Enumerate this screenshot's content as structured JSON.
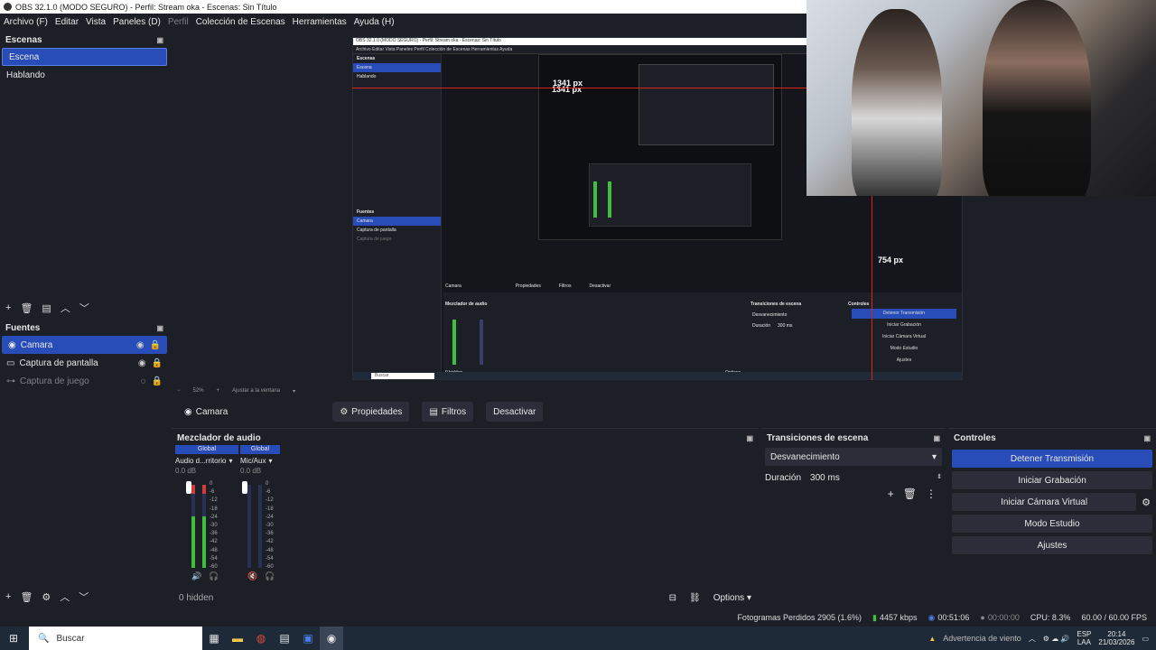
{
  "window": {
    "title": "OBS 32.1.0 (MODO SEGURO) - Perfil: Stream oka - Escenas: Sin Título"
  },
  "menu": [
    {
      "label": "Archivo (F)",
      "disabled": false
    },
    {
      "label": "Editar",
      "disabled": false
    },
    {
      "label": "Vista",
      "disabled": false
    },
    {
      "label": "Paneles (D)",
      "disabled": false
    },
    {
      "label": "Perfil",
      "disabled": true
    },
    {
      "label": "Colección de Escenas",
      "disabled": false
    },
    {
      "label": "Herramientas",
      "disabled": false
    },
    {
      "label": "Ayuda (H)",
      "disabled": false
    }
  ],
  "scenes": {
    "title": "Escenas",
    "items": [
      "Escena",
      "Hablando"
    ]
  },
  "sources": {
    "title": "Fuentes",
    "items": [
      {
        "label": "Camara",
        "icon": "camera-icon"
      },
      {
        "label": "Captura de pantalla",
        "icon": "monitor-icon"
      },
      {
        "label": "Captura de juego",
        "icon": "gamepad-icon"
      }
    ],
    "hidden_label": "0 hidden"
  },
  "preview": {
    "measure_h": "1341 px",
    "measure_v": "754 px",
    "zoom": "52%",
    "fit_label": "Ajustar a la ventana",
    "inner": {
      "menu": "Archivo Editar Vista Paneles Perfil Colección de Escenas Herramientas Ayuda",
      "scenes_title": "Escenas",
      "scenes": [
        "Escena",
        "Hablando"
      ],
      "sources_title": "Fuentes",
      "sources": [
        "Camara",
        "Captura de pantalla",
        "Captura de juego"
      ],
      "measure_h": "1341 px",
      "ctx_source": "Camara",
      "ctx_props": "Propiedades",
      "ctx_filters": "Filtros",
      "ctx_deactivate": "Desactivar",
      "mixer_title": "Mezclador de audio",
      "transitions_title": "Transiciones de escena",
      "transition_value": "Desvanecimiento",
      "duration_label": "Duración",
      "duration_value": "300 ms",
      "controls_title": "Controles",
      "controls": [
        "Detener Transmisión",
        "Iniciar Grabación",
        "Iniciar Cámara Virtual",
        "Modo Estudio",
        "Ajustes"
      ],
      "hidden_label": "0 hidden",
      "options_label": "Options",
      "taskbar_search": "Buscar"
    }
  },
  "context_bar": {
    "source": "Camara",
    "properties": "Propiedades",
    "filters": "Filtros",
    "deactivate": "Desactivar"
  },
  "mixer": {
    "title": "Mezclador de audio",
    "channels": [
      {
        "scope": "Global",
        "name": "Audio d...rritorio",
        "db": "0.0 dB",
        "level": 0.62,
        "clip": true
      },
      {
        "scope": "Global",
        "name": "Mic/Aux",
        "db": "0.0 dB",
        "level": 0.0,
        "clip": false
      }
    ],
    "scale": [
      "0",
      "-6",
      "-12",
      "-18",
      "-24",
      "-30",
      "-36",
      "-42",
      "-48",
      "-54",
      "-60"
    ],
    "options_label": "Options"
  },
  "transitions": {
    "title": "Transiciones de escena",
    "value": "Desvanecimiento",
    "duration_label": "Duración",
    "duration_value": "300 ms"
  },
  "controls": {
    "title": "Controles",
    "stop_stream": "Detener Transmisión",
    "start_recording": "Iniciar Grabación",
    "start_virtualcam": "Iniciar Cámara Virtual",
    "studio_mode": "Modo Estudio",
    "settings": "Ajustes"
  },
  "status": {
    "dropped": "Fotogramas Perdidos 2905 (1.6%)",
    "bitrate": "4457 kbps",
    "stream_time": "00:51:06",
    "rec_time": "00:00:00",
    "cpu": "CPU: 8.3%",
    "fps": "60.00 / 60.00 FPS"
  },
  "taskbar": {
    "search": "Buscar",
    "weather": "Advertencia de viento",
    "lang": "ESP",
    "lang2": "LAA",
    "time": "20:14",
    "date": "21/03/2026"
  },
  "colors": {
    "accent": "#284cb8",
    "panel": "#1d1f26",
    "red_guide": "#e0201a",
    "meter_green": "#3fbf3f"
  }
}
